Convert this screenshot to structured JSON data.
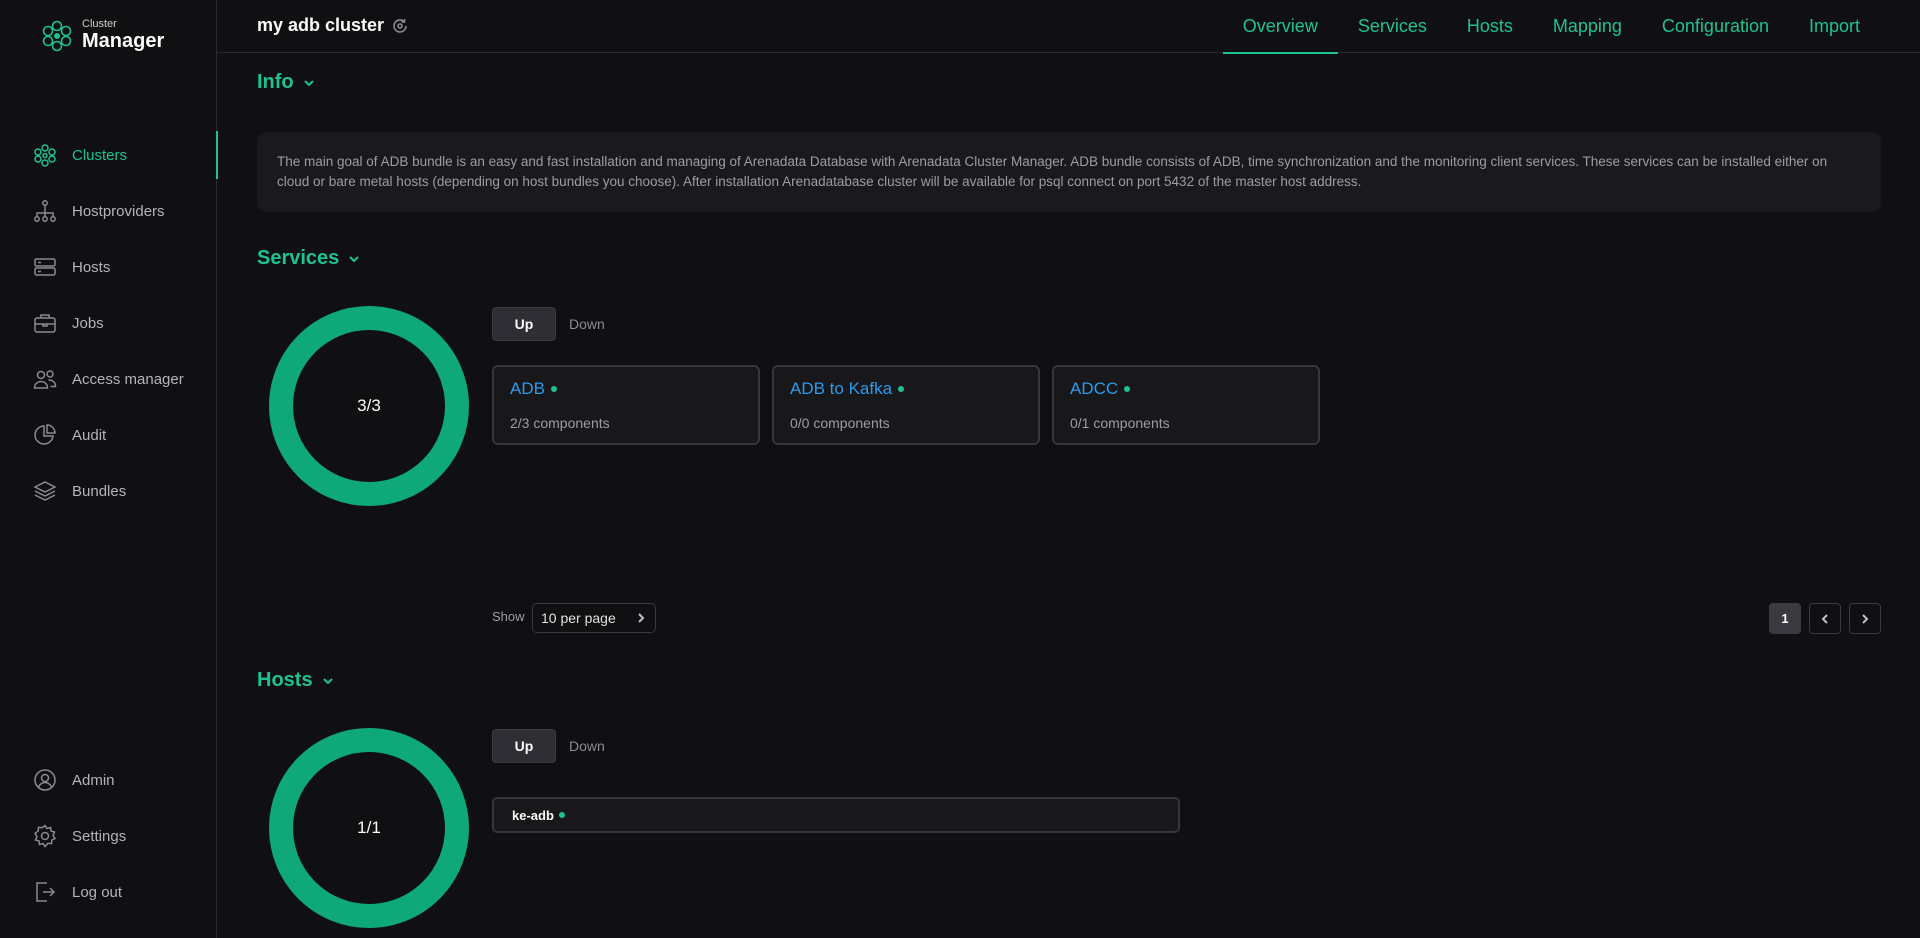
{
  "brand": {
    "small": "Cluster",
    "big": "Manager"
  },
  "sidebar": {
    "items": [
      {
        "label": "Clusters",
        "icon": "clusters-icon"
      },
      {
        "label": "Hostproviders",
        "icon": "hostproviders-icon"
      },
      {
        "label": "Hosts",
        "icon": "hosts-icon"
      },
      {
        "label": "Jobs",
        "icon": "jobs-icon"
      },
      {
        "label": "Access manager",
        "icon": "access-manager-icon"
      },
      {
        "label": "Audit",
        "icon": "audit-icon"
      },
      {
        "label": "Bundles",
        "icon": "bundles-icon"
      }
    ],
    "bottom": [
      {
        "label": "Admin",
        "icon": "admin-icon"
      },
      {
        "label": "Settings",
        "icon": "gear-icon"
      },
      {
        "label": "Log out",
        "icon": "logout-icon"
      }
    ]
  },
  "header": {
    "title": "my adb cluster",
    "tabs": [
      "Overview",
      "Services",
      "Hosts",
      "Mapping",
      "Configuration",
      "Import"
    ],
    "active_tab": "Overview"
  },
  "info": {
    "title": "Info",
    "text": "The main goal of ADB bundle is an easy and fast installation and managing of Arenadata Database with Arenadata Cluster Manager. ADB bundle consists of ADB, time synchronization and the monitoring client services. These services can be installed either on cloud or bare metal hosts (depending on host bundles you choose). After installation Arenadatabase cluster will be available for psql connect on port 5432 of the master host address."
  },
  "services": {
    "title": "Services",
    "donut_label": "3/3",
    "up_label": "Up",
    "down_label": "Down",
    "cards": [
      {
        "name": "ADB",
        "components": "2/3 components"
      },
      {
        "name": "ADB to Kafka",
        "components": "0/0 components"
      },
      {
        "name": "ADCC",
        "components": "0/1 components"
      }
    ],
    "show_label": "Show",
    "per_page": "10 per page",
    "page": "1"
  },
  "hosts": {
    "title": "Hosts",
    "donut_label": "1/1",
    "up_label": "Up",
    "down_label": "Down",
    "items": [
      {
        "name": "ke-adb"
      }
    ]
  },
  "colors": {
    "accent": "#1ec291",
    "link": "#2b9ae8",
    "background": "#101012"
  }
}
